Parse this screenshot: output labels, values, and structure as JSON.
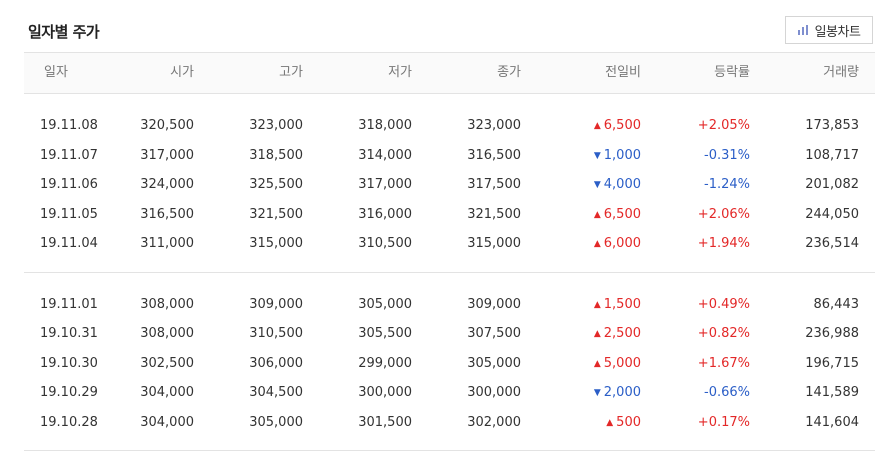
{
  "title": "일자별 주가",
  "chart_button_label": "일봉차트",
  "chart_button_icon": "bar-chart-icon",
  "columns": [
    "일자",
    "시가",
    "고가",
    "저가",
    "종가",
    "전일비",
    "등락률",
    "거래량"
  ],
  "colors": {
    "up": "#e32828",
    "down": "#2b5ec7"
  },
  "groups": [
    [
      {
        "date": "19.11.08",
        "open": "320,500",
        "high": "323,000",
        "low": "318,000",
        "close": "323,000",
        "dir": "up",
        "diff": "6,500",
        "rate": "+2.05%",
        "volume": "173,853"
      },
      {
        "date": "19.11.07",
        "open": "317,000",
        "high": "318,500",
        "low": "314,000",
        "close": "316,500",
        "dir": "down",
        "diff": "1,000",
        "rate": "-0.31%",
        "volume": "108,717"
      },
      {
        "date": "19.11.06",
        "open": "324,000",
        "high": "325,500",
        "low": "317,000",
        "close": "317,500",
        "dir": "down",
        "diff": "4,000",
        "rate": "-1.24%",
        "volume": "201,082"
      },
      {
        "date": "19.11.05",
        "open": "316,500",
        "high": "321,500",
        "low": "316,000",
        "close": "321,500",
        "dir": "up",
        "diff": "6,500",
        "rate": "+2.06%",
        "volume": "244,050"
      },
      {
        "date": "19.11.04",
        "open": "311,000",
        "high": "315,000",
        "low": "310,500",
        "close": "315,000",
        "dir": "up",
        "diff": "6,000",
        "rate": "+1.94%",
        "volume": "236,514"
      }
    ],
    [
      {
        "date": "19.11.01",
        "open": "308,000",
        "high": "309,000",
        "low": "305,000",
        "close": "309,000",
        "dir": "up",
        "diff": "1,500",
        "rate": "+0.49%",
        "volume": "86,443"
      },
      {
        "date": "19.10.31",
        "open": "308,000",
        "high": "310,500",
        "low": "305,500",
        "close": "307,500",
        "dir": "up",
        "diff": "2,500",
        "rate": "+0.82%",
        "volume": "236,988"
      },
      {
        "date": "19.10.30",
        "open": "302,500",
        "high": "306,000",
        "low": "299,000",
        "close": "305,000",
        "dir": "up",
        "diff": "5,000",
        "rate": "+1.67%",
        "volume": "196,715"
      },
      {
        "date": "19.10.29",
        "open": "304,000",
        "high": "304,500",
        "low": "300,000",
        "close": "300,000",
        "dir": "down",
        "diff": "2,000",
        "rate": "-0.66%",
        "volume": "141,589"
      },
      {
        "date": "19.10.28",
        "open": "304,000",
        "high": "305,000",
        "low": "301,500",
        "close": "302,000",
        "dir": "up",
        "diff": "500",
        "rate": "+0.17%",
        "volume": "141,604"
      }
    ]
  ]
}
